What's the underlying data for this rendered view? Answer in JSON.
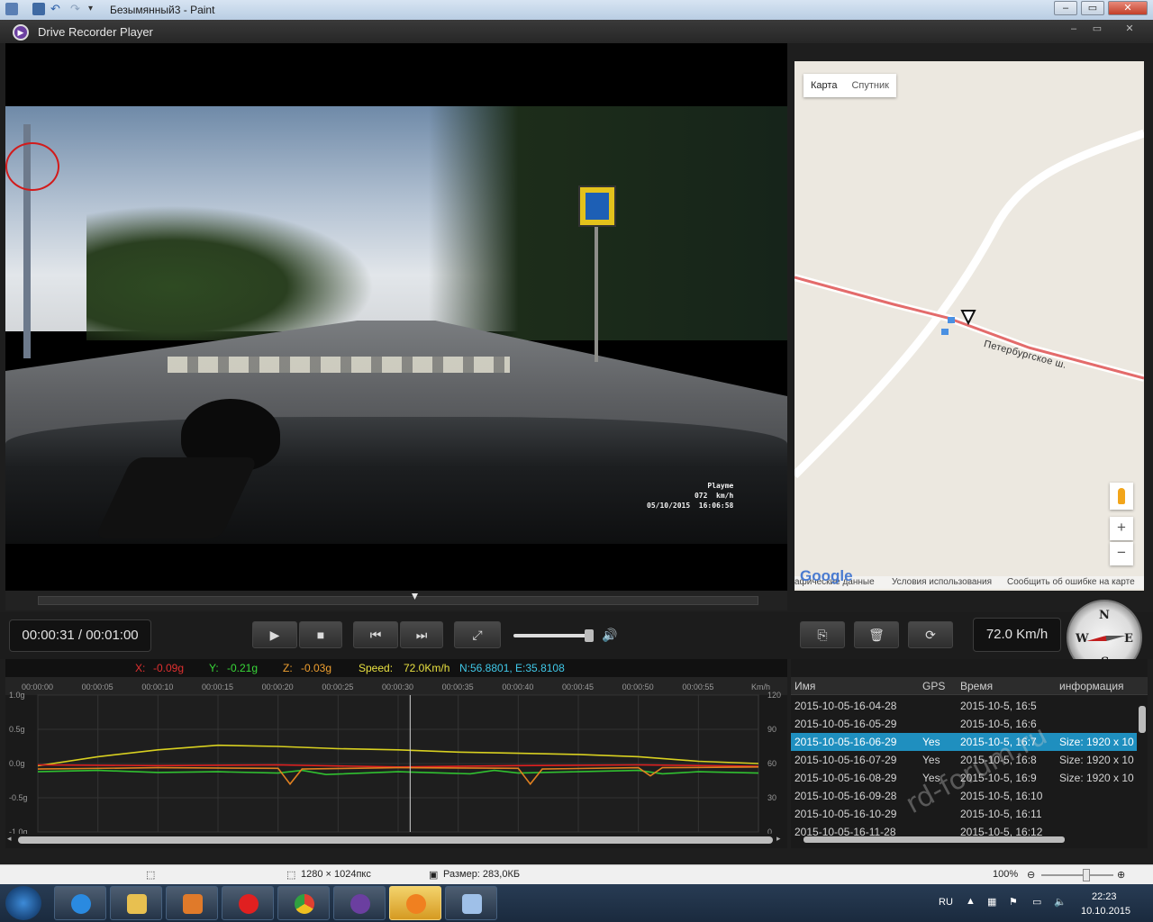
{
  "paint": {
    "title": "Безымянный3 - Paint",
    "status_dimensions": "1280 × 1024пкс",
    "status_size": "Размер: 283,0КБ",
    "zoom": "100%"
  },
  "app": {
    "title": "Drive Recorder Player",
    "time_display": "00:00:31 / 00:01:00",
    "speed_display": "72.0 Km/h"
  },
  "video": {
    "osd_brand": "Playme",
    "osd_speed": "072  km/h",
    "osd_datetime": "05/10/2015  16:06:58"
  },
  "map": {
    "tab_map": "Карта",
    "tab_satellite": "Спутник",
    "road_label": "Петербургское ш.",
    "zoom_in": "+",
    "zoom_out": "−",
    "logo": "Google",
    "footer_data": "афические данные",
    "footer_terms": "Условия использования",
    "footer_report": "Сообщить об ошибке на карте"
  },
  "compass": {
    "n": "N",
    "s": "S",
    "e": "E",
    "w": "W"
  },
  "sensor": {
    "x_label": "X:",
    "x_value": "-0.09g",
    "y_label": "Y:",
    "y_value": "-0.21g",
    "z_label": "Z:",
    "z_value": "-0.03g",
    "speed_label": "Speed:",
    "speed_value": "72.0Km/h",
    "coords": "N:56.8801, E:35.8108",
    "colors": {
      "x": "#e03030",
      "y": "#38d838",
      "z": "#f0a030",
      "speed": "#e8e040",
      "coords": "#40c8e8"
    }
  },
  "chart_data": {
    "type": "line",
    "x": [
      "00:00:00",
      "00:00:05",
      "00:00:10",
      "00:00:15",
      "00:00:20",
      "00:00:25",
      "00:00:30",
      "00:00:35",
      "00:00:40",
      "00:00:45",
      "00:00:50",
      "00:00:55"
    ],
    "x_unit": "",
    "left_ticks": [
      "1.0g",
      "0.5g",
      "0.0g",
      "-0.5g",
      "-1.0g"
    ],
    "right_ticks": [
      "120",
      "90",
      "60",
      "30",
      "0"
    ],
    "right_unit": "Km/h",
    "ylim_left": [
      -1.0,
      1.0
    ],
    "ylim_right": [
      0,
      120
    ],
    "cursor_time": 31,
    "series": [
      {
        "name": "Speed",
        "color": "#d8d020",
        "axis": "right",
        "t": [
          0,
          5,
          10,
          15,
          20,
          25,
          30,
          35,
          40,
          45,
          50,
          55,
          60
        ],
        "values": [
          58,
          66,
          72,
          76,
          75,
          73,
          72,
          70,
          69,
          68,
          66,
          62,
          60
        ]
      },
      {
        "name": "X",
        "color": "#e02020",
        "axis": "left",
        "t": [
          0,
          10,
          20,
          30,
          40,
          50,
          60
        ],
        "values": [
          -0.02,
          -0.03,
          -0.02,
          -0.05,
          -0.03,
          -0.02,
          -0.04
        ]
      },
      {
        "name": "Y",
        "color": "#30c030",
        "axis": "left",
        "t": [
          0,
          5,
          10,
          15,
          20,
          22,
          24,
          30,
          36,
          38,
          40,
          45,
          50,
          52,
          55,
          60
        ],
        "values": [
          -0.12,
          -0.1,
          -0.13,
          -0.12,
          -0.14,
          -0.1,
          -0.16,
          -0.12,
          -0.15,
          -0.1,
          -0.14,
          -0.12,
          -0.1,
          -0.15,
          -0.12,
          -0.14
        ]
      },
      {
        "name": "Z",
        "color": "#e08020",
        "axis": "left",
        "t": [
          0,
          10,
          20,
          21,
          22,
          30,
          40,
          41,
          42,
          50,
          51,
          52,
          60
        ],
        "values": [
          -0.08,
          -0.06,
          -0.07,
          -0.3,
          -0.08,
          -0.06,
          -0.07,
          -0.3,
          -0.08,
          -0.06,
          -0.18,
          -0.06,
          -0.05
        ]
      }
    ]
  },
  "files": {
    "headers": [
      "Имя",
      "GPS",
      "Время",
      "информация"
    ],
    "rows": [
      {
        "name": "2015-10-05-16-04-28",
        "gps": "",
        "time": "2015-10-5, 16:5",
        "info": ""
      },
      {
        "name": "2015-10-05-16-05-29",
        "gps": "",
        "time": "2015-10-5, 16:6",
        "info": ""
      },
      {
        "name": "2015-10-05-16-06-29",
        "gps": "Yes",
        "time": "2015-10-5, 16:7",
        "info": "Size: 1920 x 10",
        "selected": true
      },
      {
        "name": "2015-10-05-16-07-29",
        "gps": "Yes",
        "time": "2015-10-5, 16:8",
        "info": "Size: 1920 x 10"
      },
      {
        "name": "2015-10-05-16-08-29",
        "gps": "Yes",
        "time": "2015-10-5, 16:9",
        "info": "Size: 1920 x 10"
      },
      {
        "name": "2015-10-05-16-09-28",
        "gps": "",
        "time": "2015-10-5, 16:10",
        "info": ""
      },
      {
        "name": "2015-10-05-16-10-29",
        "gps": "",
        "time": "2015-10-5, 16:11",
        "info": ""
      },
      {
        "name": "2015-10-05-16-11-28",
        "gps": "",
        "time": "2015-10-5, 16:12",
        "info": ""
      }
    ]
  },
  "taskbar": {
    "lang": "RU",
    "time": "22:23",
    "date": "10.10.2015"
  },
  "watermark": "rd-forum.ru"
}
